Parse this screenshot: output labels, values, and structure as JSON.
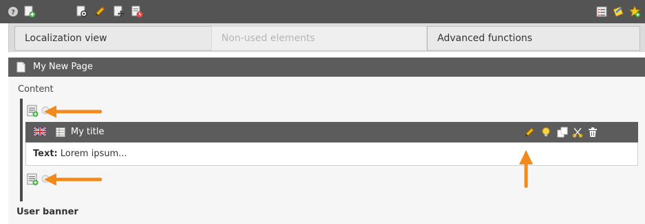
{
  "toolbar": {
    "left_icons": [
      "help-icon",
      "new-page-icon",
      "view-page-icon",
      "edit-pencil-icon",
      "move-page-icon",
      "page-history-icon"
    ],
    "right_icons": [
      "list-view-icon",
      "edit-note-icon",
      "bookmark-star-icon"
    ]
  },
  "tabs": [
    {
      "label": "Localization view",
      "enabled": true
    },
    {
      "label": "Non-used elements",
      "enabled": false
    },
    {
      "label": "Advanced functions",
      "enabled": true
    }
  ],
  "page": {
    "title": "My New Page"
  },
  "content_column": {
    "label": "Content",
    "element": {
      "title": "My title",
      "language_flag": "uk-flag-icon",
      "type_icon": "table-icon",
      "body_label": "Text:",
      "body_value": "Lorem ipsum...",
      "actions": [
        "edit-pencil-icon",
        "hide-bulb-icon",
        "copy-icon",
        "cut-icon",
        "delete-icon"
      ]
    }
  },
  "user_banner": {
    "label": "User banner"
  },
  "colors": {
    "toolbar_bg": "#545454",
    "header_bg": "#5c5c5c",
    "arrow": "#f28a1a"
  }
}
